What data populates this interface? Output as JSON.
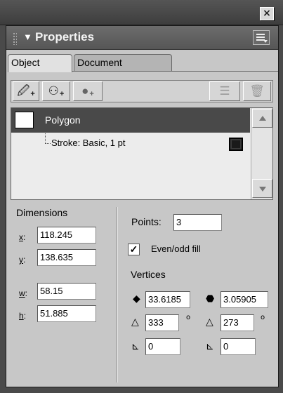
{
  "window": {
    "close_label": "×"
  },
  "panel": {
    "title": "Properties",
    "collapse_glyph": "▼"
  },
  "tabs": [
    {
      "label": "Object",
      "active": true
    },
    {
      "label": "Document",
      "active": false
    }
  ],
  "toolbar": {
    "buttons": [
      {
        "icon": "pen-add-icon",
        "glyph": "🖉"
      },
      {
        "icon": "fill-add-icon",
        "glyph": "⚇"
      },
      {
        "icon": "effect-add-icon",
        "glyph": "●"
      },
      {
        "icon": "list-delete-icon",
        "glyph": "☰"
      },
      {
        "icon": "trash-icon",
        "glyph": "🗑"
      }
    ],
    "plus": "+"
  },
  "objects": {
    "polygon_label": "Polygon",
    "stroke_label": "Stroke: Basic, 1 pt"
  },
  "dimensions": {
    "heading": "Dimensions",
    "x_key": "x",
    "x_value": "118.245",
    "y_key": "y",
    "y_value": "138.635",
    "w_key": "w",
    "w_value": "58.15",
    "h_key": "h",
    "h_value": "51.885"
  },
  "polygon": {
    "points_label": "Points:",
    "points_value": "3",
    "evenodd_label": "Even/odd fill",
    "evenodd_checked": true,
    "check_glyph": "✓",
    "vertices_heading": "Vertices",
    "v1_a": "33.6185",
    "v1_b": "3.05905",
    "angle_a": "333",
    "angle_b": "273",
    "corner_a": "0",
    "corner_b": "0",
    "degree_glyph": "o"
  },
  "colors": {
    "panel_bg": "#c7c7c7",
    "title_bg": "#5f5f5f",
    "selected_row": "#494949"
  }
}
